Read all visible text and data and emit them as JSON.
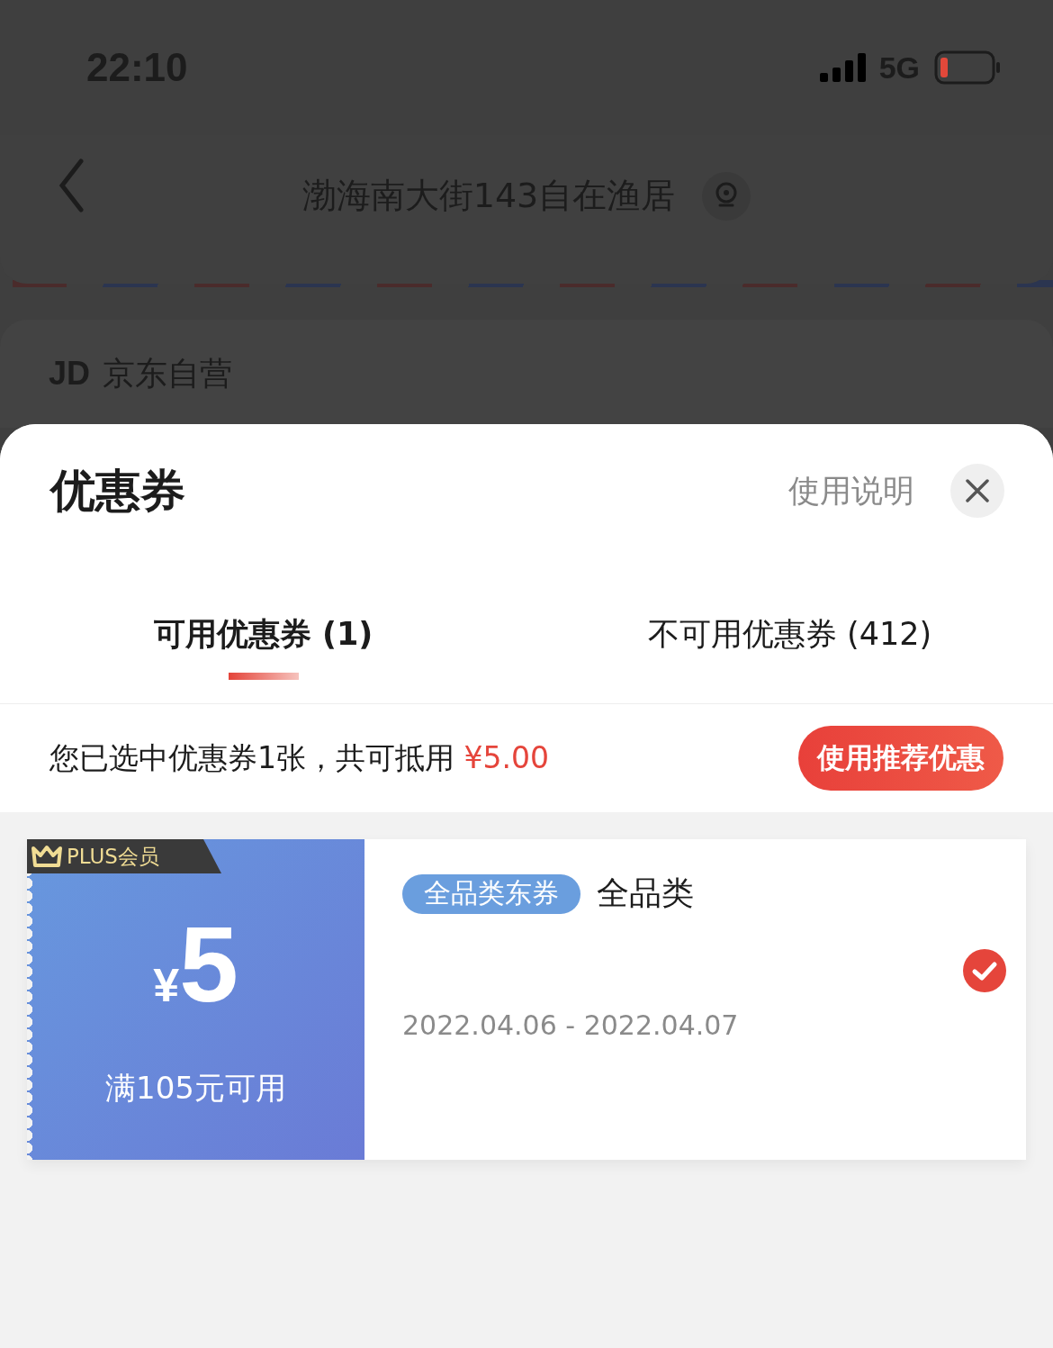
{
  "status_bar": {
    "time": "22:10",
    "network": "5G"
  },
  "header": {
    "title": "渤海南大街143自在渔居"
  },
  "store": {
    "logo": "JD",
    "name": "京东自营"
  },
  "sheet": {
    "title": "优惠券",
    "help_link": "使用说明",
    "tabs": [
      {
        "label": "可用优惠券 (1)",
        "selected": true
      },
      {
        "label": "不可用优惠券 (412)",
        "selected": false
      }
    ],
    "summary": "您已选中优惠券1张，共可抵用",
    "amount": "¥5.00",
    "recommend_button": "使用推荐优惠",
    "coupons": [
      {
        "badge": "PLUS会员",
        "currency": "¥",
        "value": "5",
        "condition": "满105元可用",
        "tag": "全品类东券",
        "scope": "全品类",
        "validity": "2022.04.06 - 2022.04.07",
        "selected": true
      }
    ]
  }
}
